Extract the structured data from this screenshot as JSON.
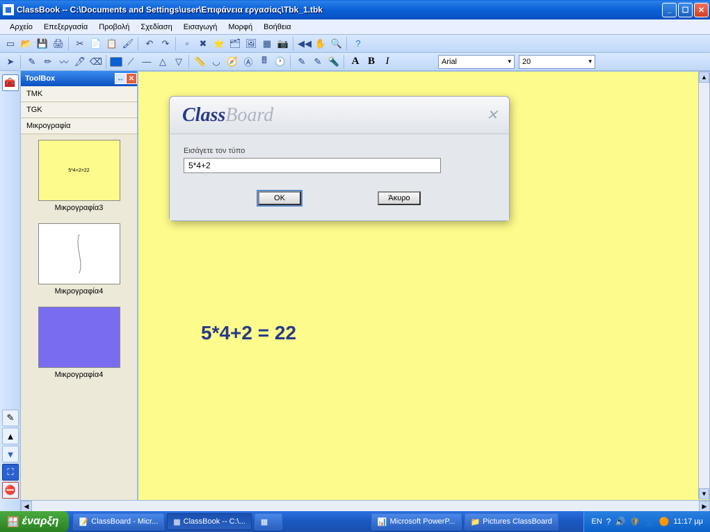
{
  "window": {
    "title": "ClassBook -- C:\\Documents and Settings\\user\\Επιφάνεια εργασίας\\Tbk_1.tbk"
  },
  "menu": {
    "file": "Αρχείο",
    "edit": "Επεξεργασία",
    "view": "Προβολή",
    "design": "Σχεδίαση",
    "insert": "Εισαγωγή",
    "format": "Μορφή",
    "help": "Βοήθεια"
  },
  "font": {
    "name": "Arial",
    "size": "20"
  },
  "toolbox": {
    "title": "ToolBox",
    "sect1": "TMK",
    "sect2": "TGK",
    "sect3": "Μικρογραφία",
    "thumbs": [
      {
        "label": "Μικρογραφία3",
        "tiny": "5*4+2=22"
      },
      {
        "label": "Μικρογραφία4",
        "tiny": ""
      },
      {
        "label": "Μικρογραφία4",
        "tiny": ""
      }
    ]
  },
  "dialog": {
    "brand1": "Class",
    "brand2": "Board",
    "prompt": "Εισάγετε τον τύπο",
    "input": "5*4+2",
    "ok": "OK",
    "cancel": "Άκυρο"
  },
  "canvas": {
    "result": "5*4+2 = 22"
  },
  "taskbar": {
    "start": "έναρξη",
    "items": [
      "ClassBoard - Micr...",
      "ClassBook -- C:\\...",
      "",
      "Microsoft PowerP...",
      "Pictures ClassBoard"
    ],
    "lang": "EN",
    "clock": "11:17 μμ"
  }
}
